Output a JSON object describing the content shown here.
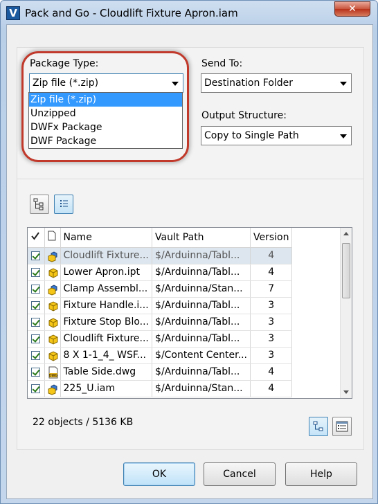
{
  "window": {
    "title": "Pack and Go - Cloudlift Fixture Apron.iam",
    "app_icon_letter": "V",
    "close_label": "✕"
  },
  "package_type": {
    "label": "Package Type:",
    "selected": "Zip file (*.zip)",
    "options": [
      "Zip file (*.zip)",
      "Unzipped",
      "DWFx Package",
      "DWF Package"
    ]
  },
  "send_to": {
    "label": "Send To:",
    "selected": "Destination Folder"
  },
  "output_structure": {
    "label": "Output Structure:",
    "selected": "Copy to Single Path"
  },
  "grid": {
    "columns": [
      "Name",
      "Vault Path",
      "Version"
    ],
    "rows": [
      {
        "name": "Cloudlift Fixture...",
        "path": "$/Arduinna/Tabl...",
        "version": "4",
        "icon": "assembly-icon",
        "selected": true
      },
      {
        "name": "Lower Apron.ipt",
        "path": "$/Arduinna/Tabl...",
        "version": "4",
        "icon": "part-icon",
        "selected": false
      },
      {
        "name": "Clamp Assembl...",
        "path": "$/Arduinna/Stan...",
        "version": "7",
        "icon": "assembly-icon",
        "selected": false
      },
      {
        "name": "Fixture Handle.i...",
        "path": "$/Arduinna/Tabl...",
        "version": "3",
        "icon": "part-icon",
        "selected": false
      },
      {
        "name": "Fixture Stop Blo...",
        "path": "$/Arduinna/Tabl...",
        "version": "3",
        "icon": "part-icon",
        "selected": false
      },
      {
        "name": "Cloudlift Fixture...",
        "path": "$/Arduinna/Tabl...",
        "version": "3",
        "icon": "part-icon",
        "selected": false
      },
      {
        "name": "8 X 1-1_4_ WSF...",
        "path": "$/Content Center...",
        "version": "3",
        "icon": "part-icon",
        "selected": false
      },
      {
        "name": "Table Side.dwg",
        "path": "$/Arduinna/Tabl...",
        "version": "4",
        "icon": "dwg-icon",
        "selected": false
      },
      {
        "name": "225_U.iam",
        "path": "$/Arduinna/Stan...",
        "version": "4",
        "icon": "assembly-icon",
        "selected": false
      }
    ]
  },
  "status": "22 objects / 5136 KB",
  "buttons": {
    "ok": "OK",
    "cancel": "Cancel",
    "help": "Help"
  }
}
